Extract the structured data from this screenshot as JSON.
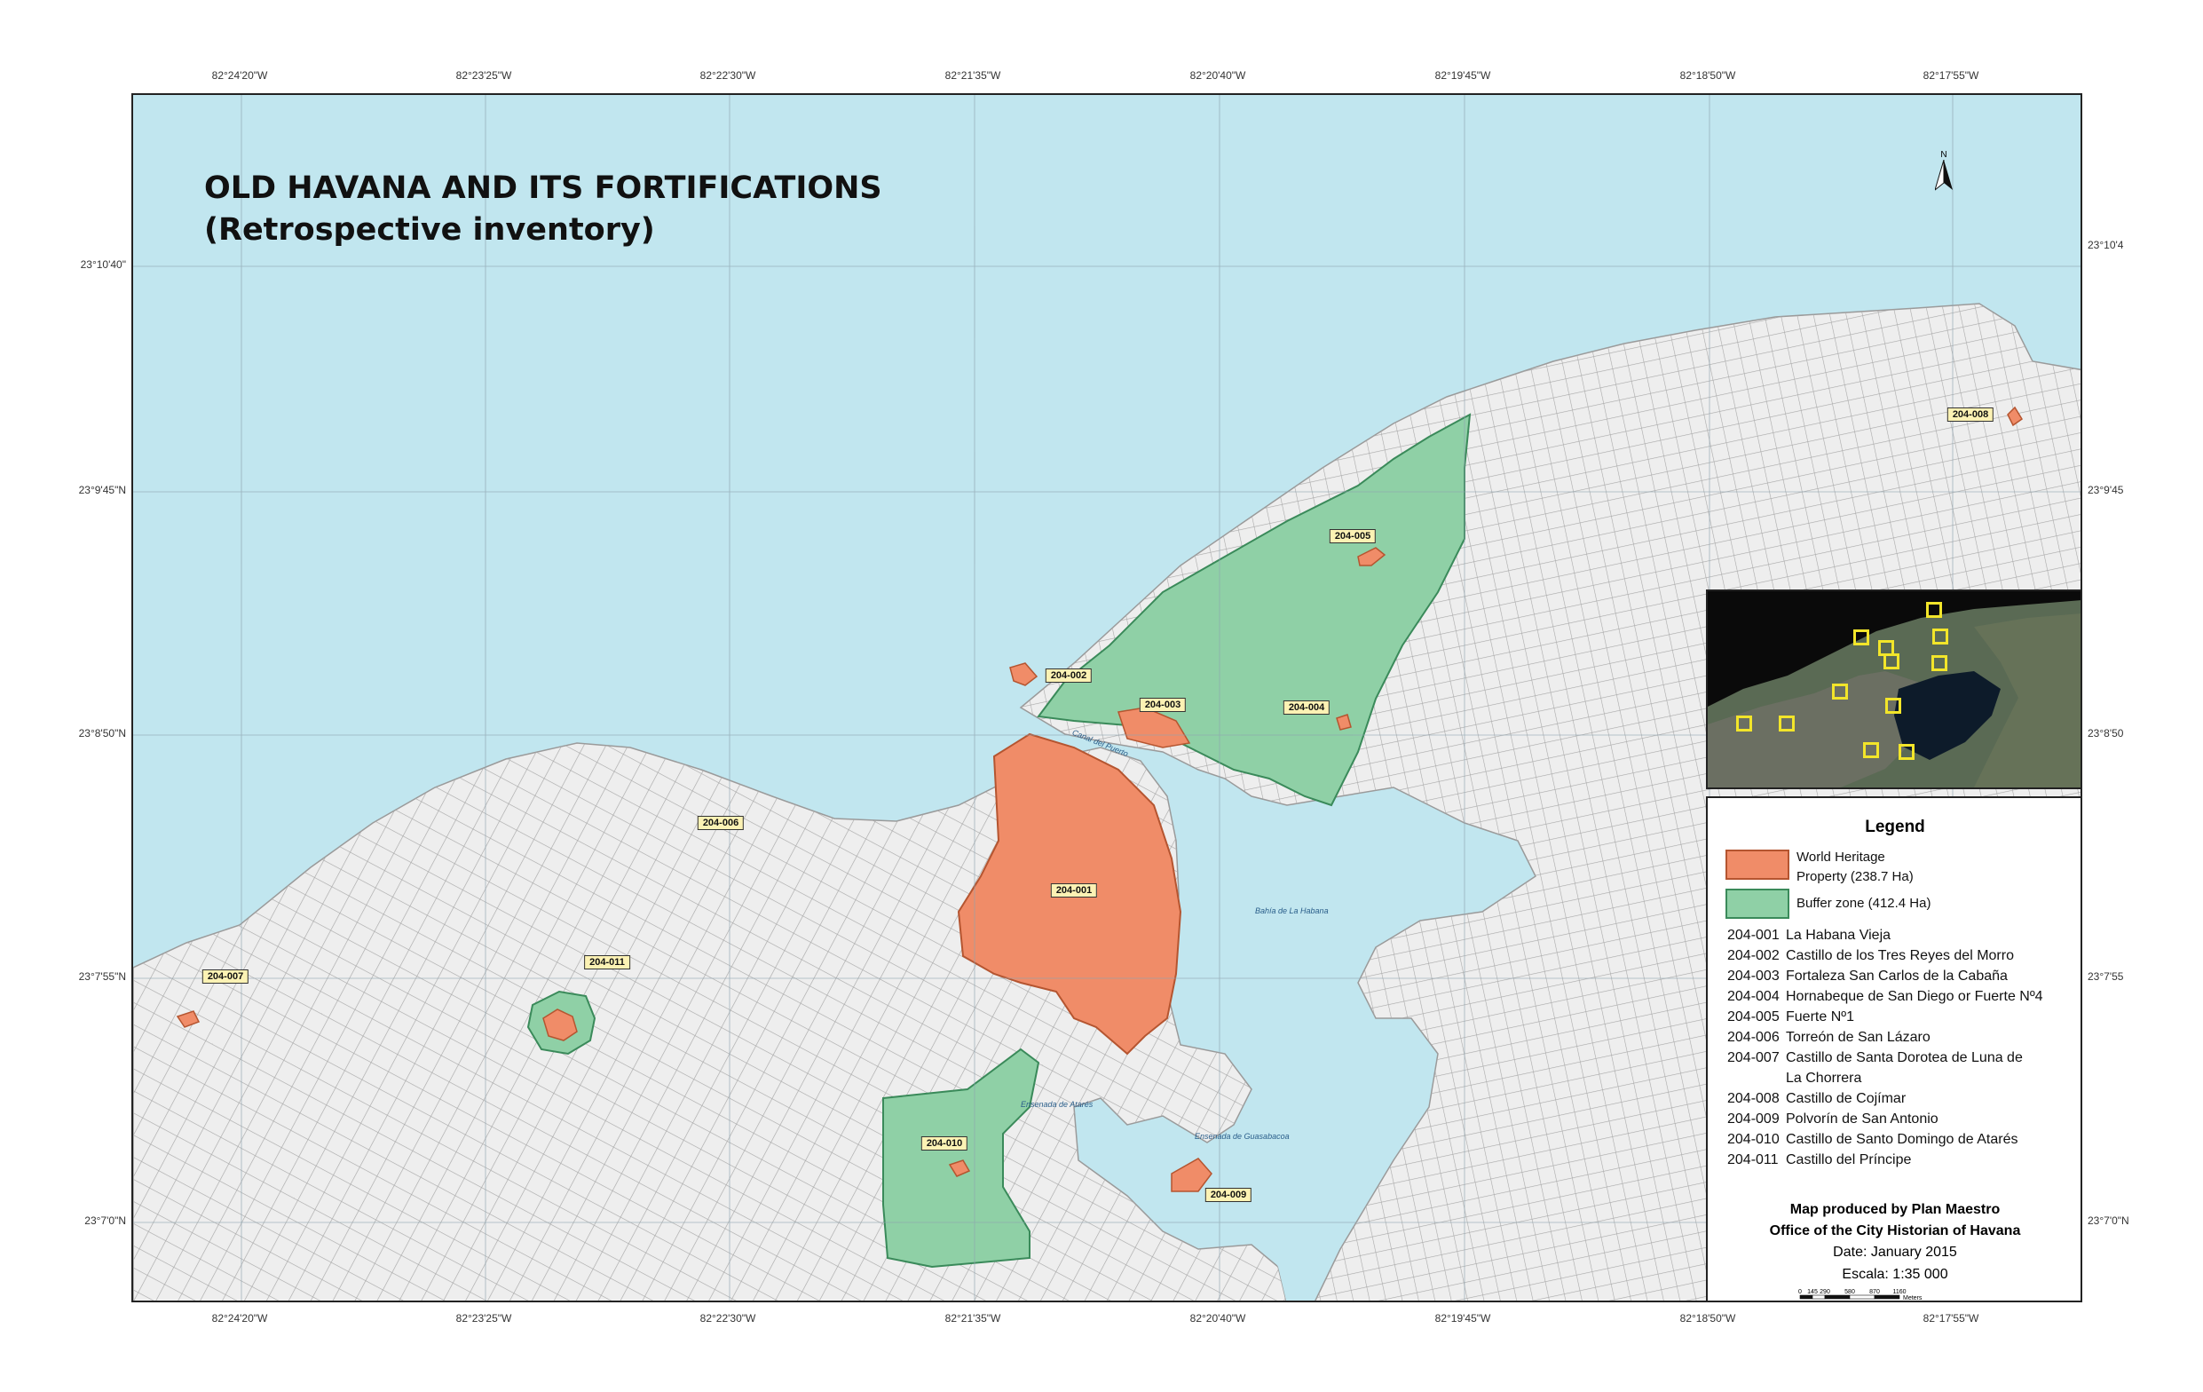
{
  "map": {
    "title_line1": "OLD HAVANA AND ITS  FORTIFICATIONS",
    "title_line2": "(Retrospective inventory)",
    "north_label": "N"
  },
  "coordinates": {
    "top": [
      "82°24'20\"W",
      "82°23'25\"W",
      "82°22'30\"W",
      "82°21'35\"W",
      "82°20'40\"W",
      "82°19'45\"W",
      "82°18'50\"W",
      "82°17'55\"W"
    ],
    "bottom": [
      "82°24'20\"W",
      "82°23'25\"W",
      "82°22'30\"W",
      "82°21'35\"W",
      "82°20'40\"W",
      "82°19'45\"W",
      "82°18'50\"W",
      "82°17'55\"W"
    ],
    "left": [
      "23°10'40\"",
      "23°9'45\"N",
      "23°8'50\"N",
      "23°7'55\"N",
      "23°7'0\"N"
    ],
    "right": [
      "23°10'4",
      "23°9'45",
      "23°8'50",
      "23°7'55",
      "23°7'0\"N"
    ]
  },
  "sites": [
    {
      "code": "204-001"
    },
    {
      "code": "204-002"
    },
    {
      "code": "204-003"
    },
    {
      "code": "204-004"
    },
    {
      "code": "204-005"
    },
    {
      "code": "204-006"
    },
    {
      "code": "204-007"
    },
    {
      "code": "204-008"
    },
    {
      "code": "204-009"
    },
    {
      "code": "204-010"
    },
    {
      "code": "204-011"
    }
  ],
  "water_labels": {
    "canal": "Canal del Puerto",
    "bahia": "Bahía de La Habana",
    "atares": "Ensenada de Atarés",
    "guasabacoa": "Ensenada de Guasabacoa"
  },
  "legend": {
    "title": "Legend",
    "whp_line1": "World Heritage",
    "whp_line2": "Property (238.7 Ha)",
    "buffer": "Buffer zone (412.4 Ha)",
    "entries": [
      {
        "code": "204-001",
        "name": "La Habana Vieja"
      },
      {
        "code": "204-002",
        "name": "Castillo de los Tres Reyes del Morro"
      },
      {
        "code": "204-003",
        "name": "Fortaleza San Carlos de la Cabaña"
      },
      {
        "code": "204-004",
        "name": "Hornabeque de San Diego or Fuerte Nº4"
      },
      {
        "code": "204-005",
        "name": "Fuerte Nº1"
      },
      {
        "code": "204-006",
        "name": "Torreón de San Lázaro"
      },
      {
        "code": "204-007",
        "name": "Castillo de Santa Dorotea de Luna de"
      },
      {
        "code": "",
        "name": "La Chorrera"
      },
      {
        "code": "204-008",
        "name": "Castillo de Cojímar"
      },
      {
        "code": "204-009",
        "name": "Polvorín de San Antonio"
      },
      {
        "code": "204-010",
        "name": "Castillo de Santo Domingo de Atarés"
      },
      {
        "code": "204-011",
        "name": "Castillo del Príncipe"
      }
    ],
    "credit1": "Map produced by Plan Maestro",
    "credit2": "Office of the City Historian of Havana",
    "date": "Date: January 2015",
    "scale": "Escala: 1:35 000",
    "scalebar_ticks": [
      "0",
      "145",
      "290",
      "580",
      "870",
      "1160"
    ],
    "scalebar_unit": "Meters"
  },
  "colors": {
    "water": "#c1e6ef",
    "land": "#eeeeee",
    "streets": "#a8a8a8",
    "world_heritage": "#f08c68",
    "buffer_zone": "#8fd0a6",
    "tag_bg": "#fcf2b4",
    "inset_marker": "#f2e52a"
  }
}
